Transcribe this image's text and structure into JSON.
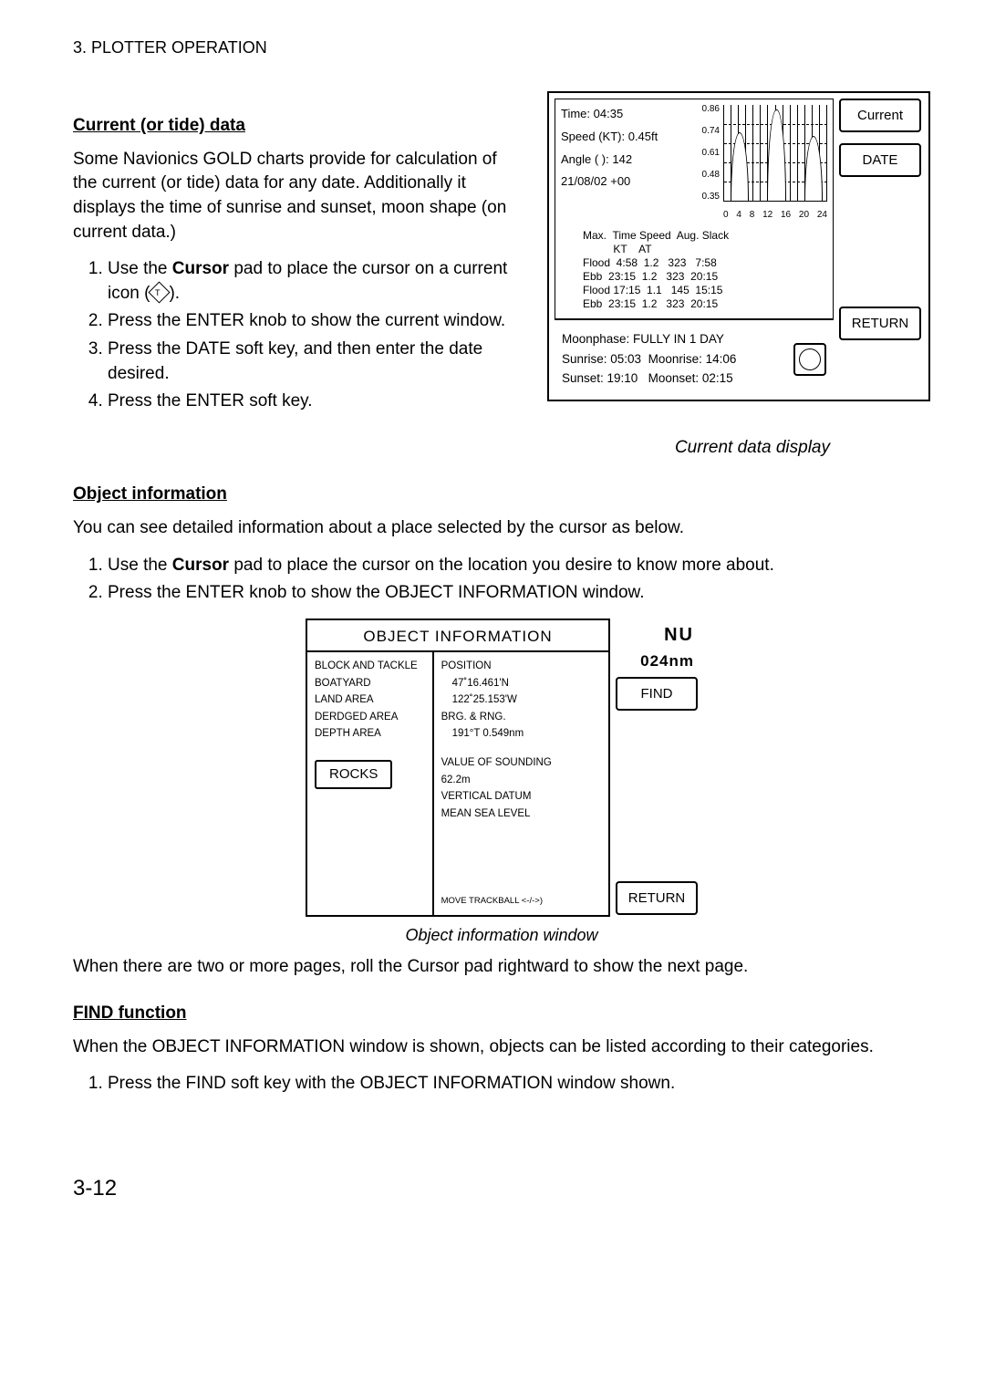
{
  "header": "3. PLOTTER OPERATION",
  "current_data": {
    "heading": "Current (or tide) data",
    "intro": "Some Navionics GOLD charts provide for calculation of the current (or tide) data for any date. Additionally it displays the time of sunrise and sunset, moon shape (on current data.)",
    "steps": [
      "Use the Cursor pad to place the cursor on a current icon (   ).",
      "Press the ENTER knob to show the current window.",
      "Press the DATE soft key, and then enter the date desired.",
      "Press the ENTER soft key."
    ],
    "softkeys": {
      "current": "Current",
      "date": "DATE",
      "return": "RETURN"
    },
    "info": {
      "time_label": "Time:",
      "time_value": "04:35",
      "speed_label": "Speed (KT):",
      "speed_value": "0.45ft",
      "angle_label": "Angle ( ):",
      "angle_value": "142",
      "date_label": "21/08/02",
      "tz": "+00"
    },
    "y_ticks": [
      "0.86",
      "0.74",
      "0.61",
      "0.48",
      "0.35"
    ],
    "x_ticks": [
      "0",
      "4",
      "8",
      "12",
      "16",
      "20",
      "24"
    ],
    "tide_header": "Max.  Time Speed  Aug. Slack\n          KT    AT",
    "tide_rows": [
      "Flood  4:58  1.2   323   7:58",
      "Ebb  23:15  1.2   323  20:15",
      "Flood 17:15  1.1   145  15:15",
      "Ebb  23:15  1.2   323  20:15"
    ],
    "moon": {
      "phase": "Moonphase: FULLY IN 1 DAY",
      "sunrise": "Sunrise: 05:03",
      "moonrise": "Moonrise: 14:06",
      "sunset": "Sunset: 19:10",
      "moonset": "Moonset: 02:15"
    },
    "caption": "Current data display"
  },
  "obj": {
    "heading": "Object information",
    "intro": "You can see detailed information about a place selected by the cursor as below.",
    "steps": [
      "Use the Cursor pad to place the cursor on the location you desire to know more about.",
      "Press the ENTER knob to show the OBJECT INFORMATION window."
    ],
    "title": "OBJECT INFORMATION",
    "NU": "NU",
    "range": "024nm",
    "col1": [
      "BLOCK AND TACKLE",
      "BOATYARD",
      "LAND AREA",
      "DERDGED AREA",
      "DEPTH AREA"
    ],
    "selected": "ROCKS",
    "col2": {
      "pos_label": "POSITION",
      "lat": "47˚16.461'N",
      "lon": "122˚25.153'W",
      "brg_label": "BRG. & RNG.",
      "brg": "191°T   0.549nm",
      "vos_label": "VALUE OF SOUNDING",
      "vos": "62.2m",
      "vd_label": "VERTICAL DATUM",
      "vd": "MEAN SEA LEVEL",
      "move": "MOVE TRACKBALL <-/->)"
    },
    "softkeys": {
      "find": "FIND",
      "return": "RETURN"
    },
    "caption": "Object information window",
    "after1": "When there are two or more pages, roll the Cursor pad rightward to show the next page."
  },
  "find": {
    "heading": "FIND function",
    "intro": "When the OBJECT INFORMATION window is shown, objects can be listed according to their categories.",
    "step1": "Press the FIND soft key with the OBJECT INFORMATION window shown."
  },
  "page_number": "3-12"
}
